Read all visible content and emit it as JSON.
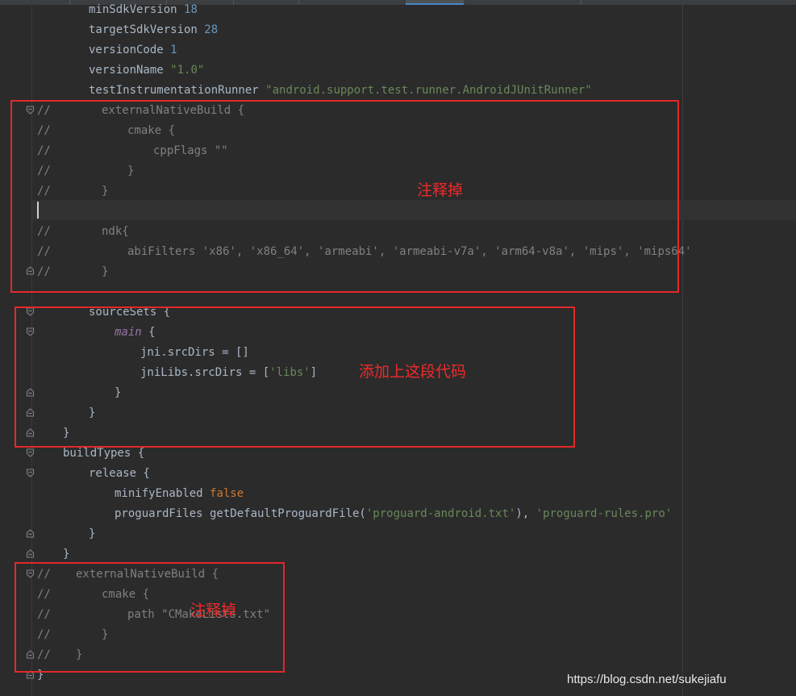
{
  "editor": {
    "lines": [
      {
        "segments": [
          {
            "t": "minSdkVersion ",
            "c": "plain"
          },
          {
            "t": "18",
            "c": "num"
          }
        ]
      },
      {
        "segments": [
          {
            "t": "targetSdkVersion ",
            "c": "plain"
          },
          {
            "t": "28",
            "c": "num"
          }
        ]
      },
      {
        "segments": [
          {
            "t": "versionCode ",
            "c": "plain"
          },
          {
            "t": "1",
            "c": "num"
          }
        ]
      },
      {
        "segments": [
          {
            "t": "versionName ",
            "c": "plain"
          },
          {
            "t": "\"1.0\"",
            "c": "str"
          }
        ]
      },
      {
        "segments": [
          {
            "t": "testInstrumentationRunner ",
            "c": "plain"
          },
          {
            "t": "\"android.support.test.runner.AndroidJUnitRunner\"",
            "c": "str"
          }
        ]
      },
      {
        "comment": "//",
        "segments": [
          {
            "t": "externalNativeBuild {",
            "c": "cm"
          }
        ]
      },
      {
        "comment": "//",
        "segments": [
          {
            "t": "cmake {",
            "c": "cm"
          }
        ]
      },
      {
        "comment": "//",
        "segments": [
          {
            "t": "cppFlags \"\"",
            "c": "cm"
          }
        ]
      },
      {
        "comment": "//",
        "segments": [
          {
            "t": "}",
            "c": "cm"
          }
        ]
      },
      {
        "comment": "//",
        "segments": [
          {
            "t": "}",
            "c": "cm"
          }
        ]
      },
      {
        "segments": []
      },
      {
        "comment": "//",
        "segments": [
          {
            "t": "ndk{",
            "c": "cm"
          }
        ]
      },
      {
        "comment": "//",
        "segments": [
          {
            "t": "abiFilters 'x86', 'x86_64', 'armeabi', 'armeabi-v7a', 'arm64-v8a', 'mips', 'mips64'",
            "c": "cm"
          }
        ]
      },
      {
        "comment": "//",
        "segments": [
          {
            "t": "}",
            "c": "cm"
          }
        ]
      },
      {
        "segments": []
      },
      {
        "segments": [
          {
            "t": "sourceSets {",
            "c": "plain"
          }
        ]
      },
      {
        "segments": [
          {
            "t": "main",
            "c": "mth"
          },
          {
            "t": " {",
            "c": "plain"
          }
        ]
      },
      {
        "segments": [
          {
            "t": "jni.srcDirs = []",
            "c": "plain"
          }
        ]
      },
      {
        "segments": [
          {
            "t": "jniLibs.srcDirs = [",
            "c": "plain"
          },
          {
            "t": "'libs'",
            "c": "str"
          },
          {
            "t": "]",
            "c": "plain"
          }
        ]
      },
      {
        "segments": [
          {
            "t": "}",
            "c": "plain"
          }
        ]
      },
      {
        "segments": [
          {
            "t": "}",
            "c": "plain"
          }
        ]
      },
      {
        "segments": [
          {
            "t": "}",
            "c": "plain"
          }
        ]
      },
      {
        "segments": [
          {
            "t": "buildTypes {",
            "c": "plain"
          }
        ]
      },
      {
        "segments": [
          {
            "t": "release {",
            "c": "plain"
          }
        ]
      },
      {
        "segments": [
          {
            "t": "minifyEnabled ",
            "c": "plain"
          },
          {
            "t": "false",
            "c": "kw"
          }
        ]
      },
      {
        "segments": [
          {
            "t": "proguardFiles getDefaultProguardFile(",
            "c": "plain"
          },
          {
            "t": "'proguard-android.txt'",
            "c": "str"
          },
          {
            "t": "), ",
            "c": "plain"
          },
          {
            "t": "'proguard-rules.pro'",
            "c": "str"
          }
        ]
      },
      {
        "segments": [
          {
            "t": "}",
            "c": "plain"
          }
        ]
      },
      {
        "segments": [
          {
            "t": "}",
            "c": "plain"
          }
        ]
      },
      {
        "comment": "//",
        "segments": [
          {
            "t": "externalNativeBuild {",
            "c": "cm"
          }
        ]
      },
      {
        "comment": "//",
        "segments": [
          {
            "t": "cmake {",
            "c": "cm"
          }
        ]
      },
      {
        "comment": "//",
        "segments": [
          {
            "t": "path \"CMakeLists.txt\"",
            "c": "cm"
          }
        ]
      },
      {
        "comment": "//",
        "segments": [
          {
            "t": "}",
            "c": "cm"
          }
        ]
      },
      {
        "comment": "//",
        "segments": [
          {
            "t": "}",
            "c": "cm"
          }
        ]
      },
      {
        "segments": [
          {
            "t": "}",
            "c": "plain"
          }
        ]
      }
    ]
  },
  "annotations": {
    "comment_out_1": "注释掉",
    "add_code": "添加上这段代码",
    "comment_out_2": "注释掉"
  },
  "watermark": "https://blog.csdn.net/sukejiafu",
  "colors": {
    "background": "#2b2b2b",
    "comment": "#808080",
    "string": "#6a8759",
    "number": "#6897bb",
    "keyword": "#cc7832",
    "annotation_red": "#e3282a"
  }
}
